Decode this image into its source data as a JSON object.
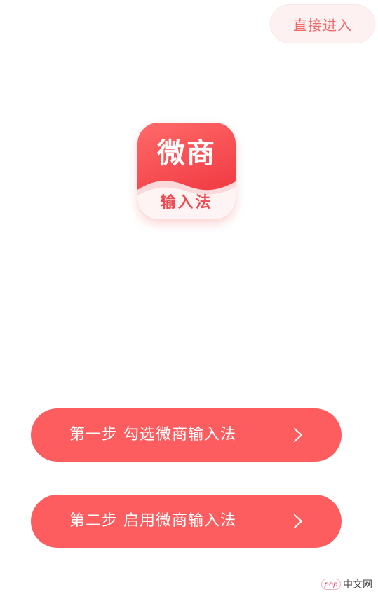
{
  "header": {
    "skip_label": "直接进入"
  },
  "logo": {
    "top_text": "微商",
    "bottom_text": "输入法"
  },
  "steps": [
    {
      "label": "第一步 勾选微商输入法",
      "icon": "chevron-right-icon"
    },
    {
      "label": "第二步 启用微商输入法",
      "icon": "chevron-right-icon"
    }
  ],
  "watermark": {
    "badge": "php",
    "text": "中文网"
  },
  "colors": {
    "primary": "#fe5d5f",
    "skip_bg": "#fdf1f1",
    "skip_text": "#f06a6a",
    "logo_red": "#f23f46"
  }
}
